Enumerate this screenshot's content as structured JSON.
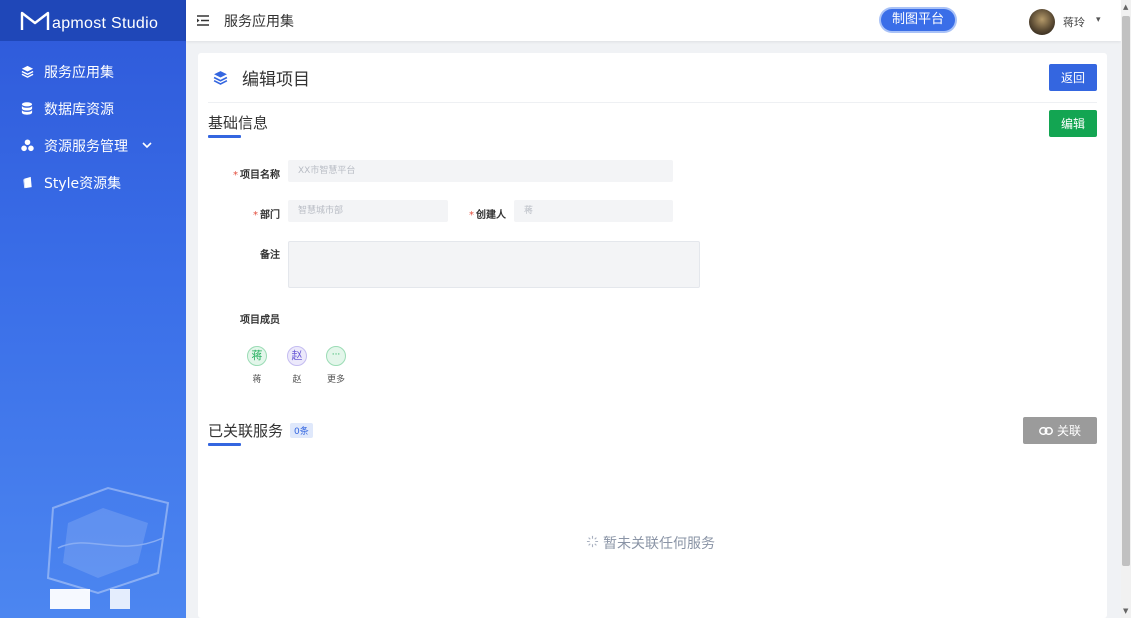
{
  "app": {
    "logo_text": "apmost Studio"
  },
  "sidebar": {
    "items": [
      {
        "label": "服务应用集",
        "icon": "layers-icon"
      },
      {
        "label": "数据库资源",
        "icon": "database-icon"
      },
      {
        "label": "资源服务管理",
        "icon": "cluster-icon",
        "has_submenu": true
      },
      {
        "label": "Style资源集",
        "icon": "style-icon"
      }
    ]
  },
  "topbar": {
    "title": "服务应用集",
    "platform_badge": "制图平台",
    "user_name": "蒋玲",
    "caret": "▾"
  },
  "page": {
    "title": "编辑项目",
    "back_label": "返回"
  },
  "basic_info": {
    "title": "基础信息",
    "edit_label": "编辑",
    "fields": {
      "project_name_label": "项目名称",
      "project_name_value": "XX市智慧平台",
      "department_label": "部门",
      "department_value": "智慧城市部",
      "creator_label": "创建人",
      "creator_value": "蒋",
      "remark_label": "备注",
      "remark_value": "",
      "members_label": "项目成员"
    },
    "members": [
      {
        "avatar": "蒋",
        "name": "蒋",
        "color": "#1fae5a",
        "bg": "#e3f6ea"
      },
      {
        "avatar": "赵",
        "name": "赵",
        "color": "#6a5bd6",
        "bg": "#ece9fb"
      },
      {
        "avatar": "···",
        "name": "更多",
        "color": "#1fae5a",
        "bg": "#e3f6ea"
      }
    ]
  },
  "linked_services": {
    "title": "已关联服务",
    "count": "0条",
    "link_label": "关联",
    "empty_text": "暂未关联任何服务"
  },
  "colors": {
    "accent": "#3466e0",
    "success": "#13a552",
    "required": "#e24d3d"
  }
}
